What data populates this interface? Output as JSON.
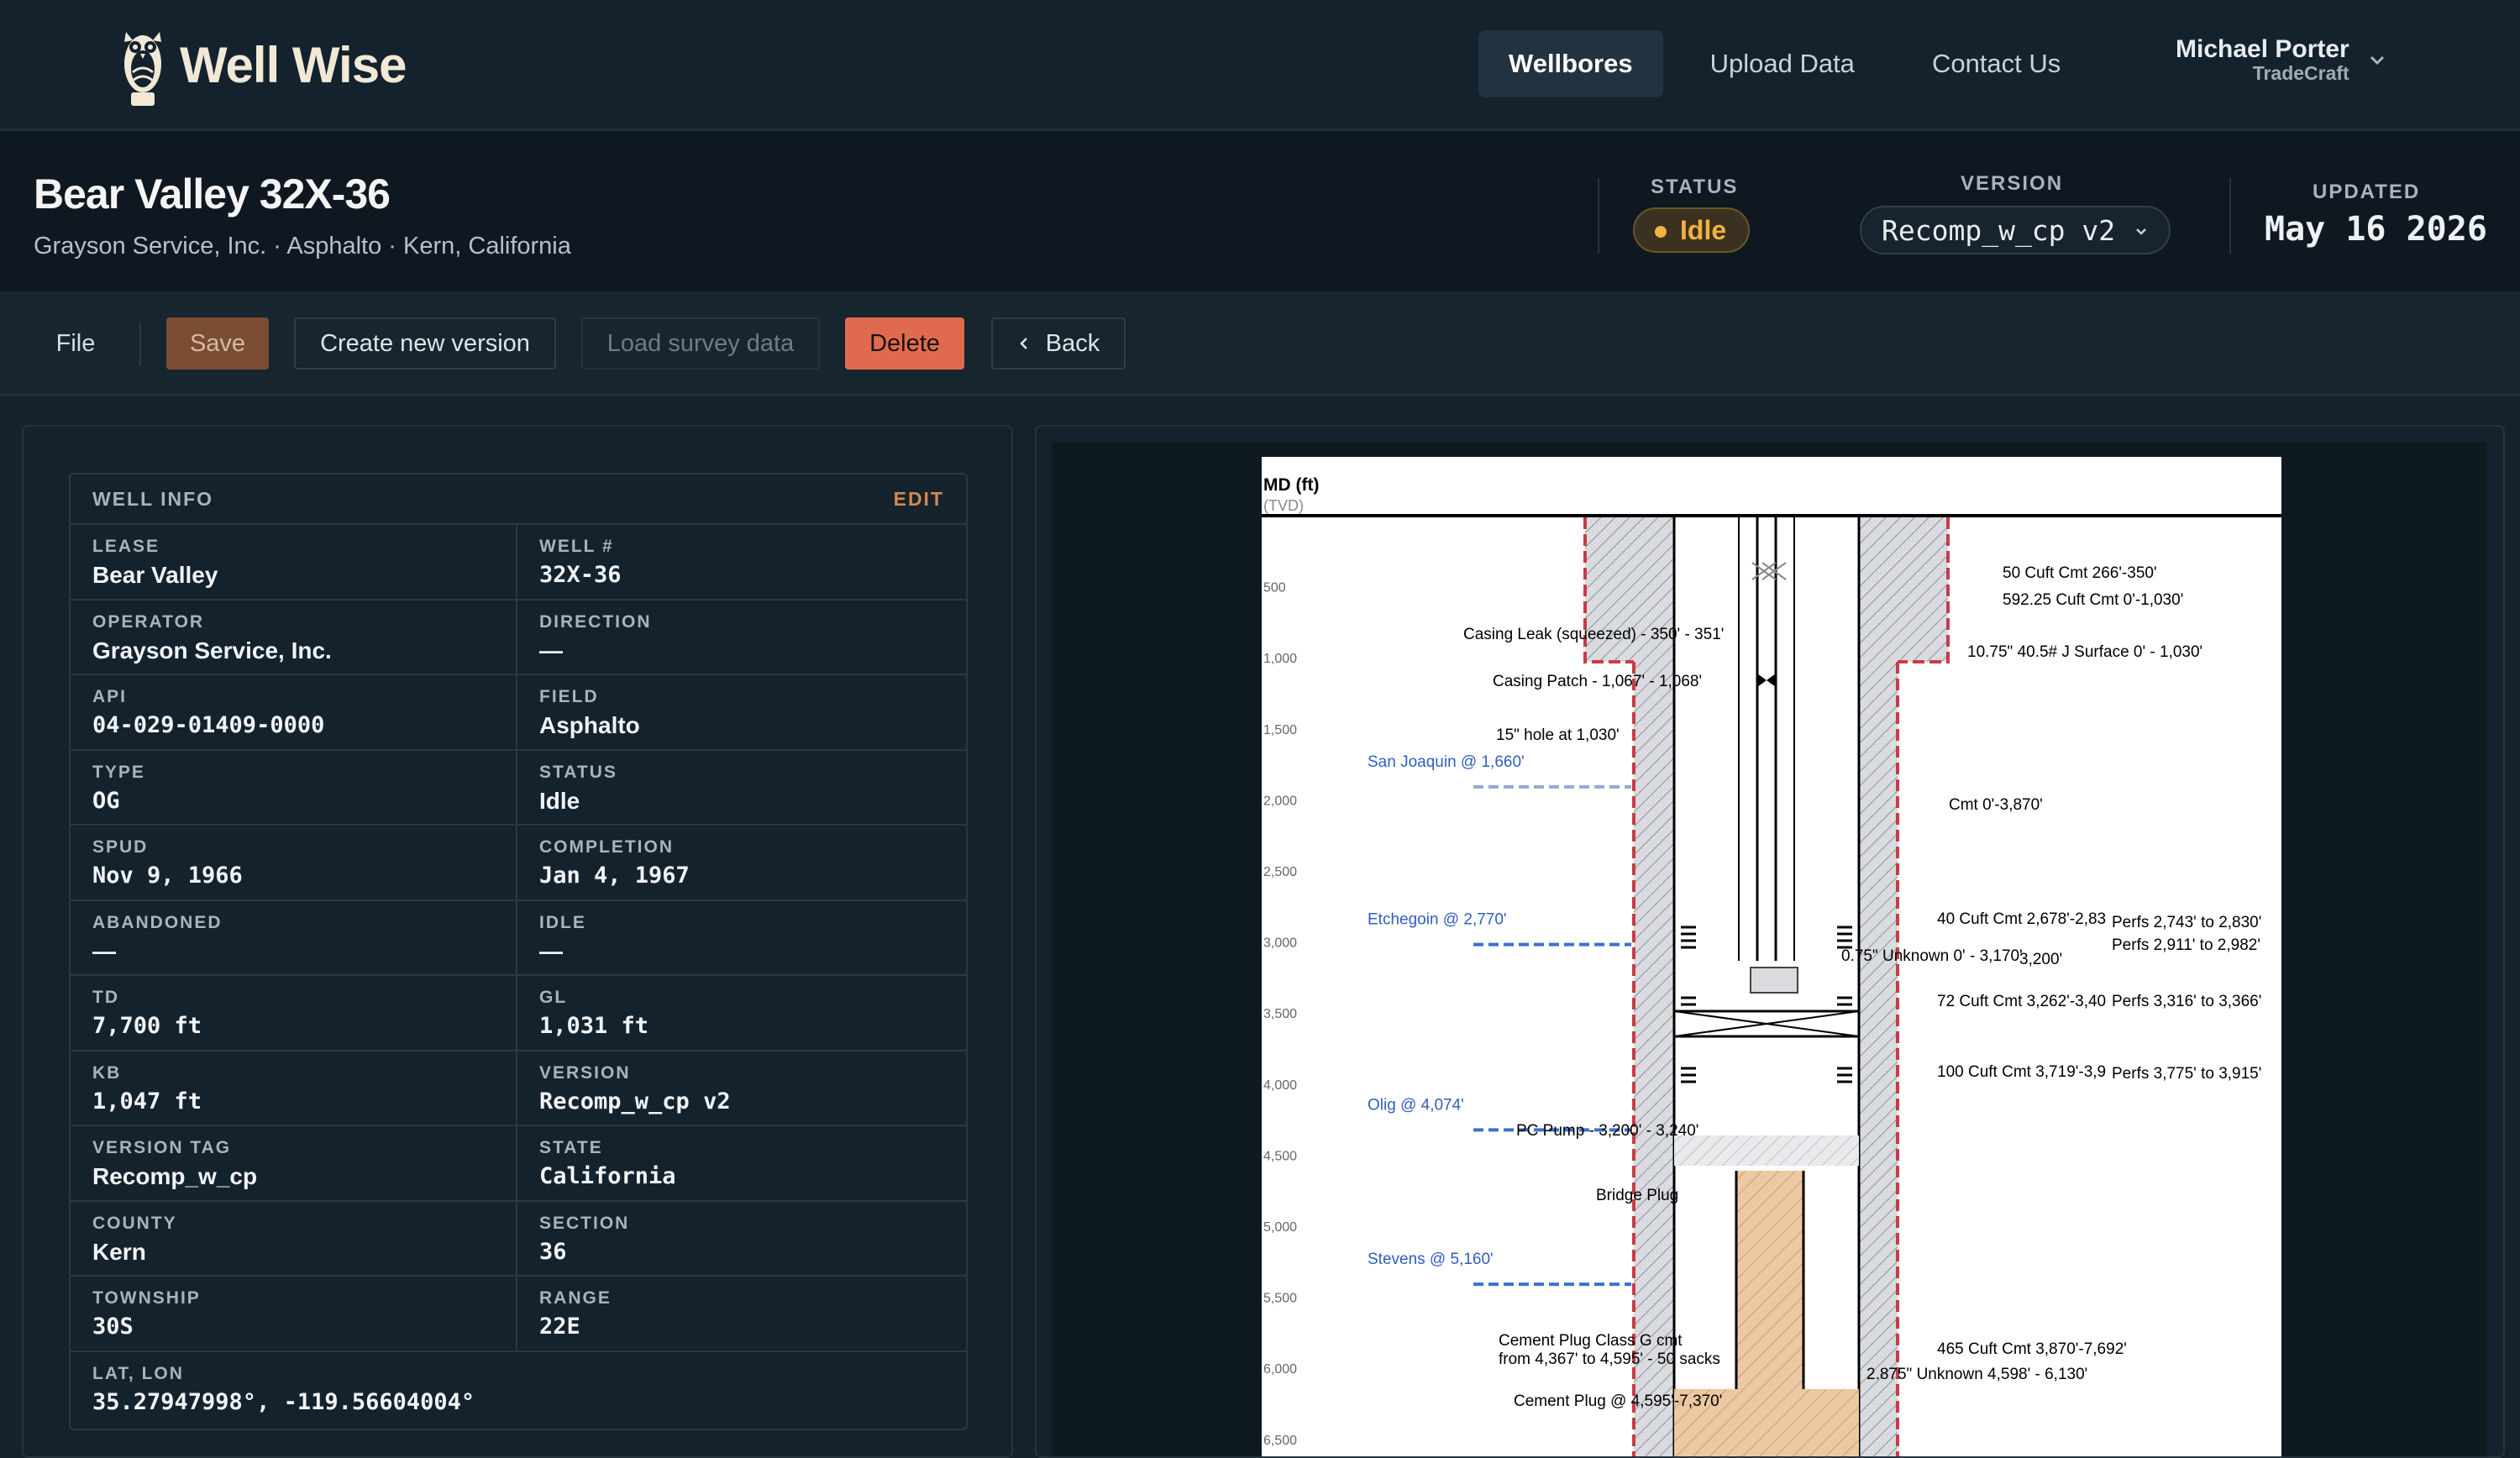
{
  "app": {
    "name": "Well Wise"
  },
  "nav": {
    "items": [
      {
        "label": "Wellbores",
        "active": true
      },
      {
        "label": "Upload Data",
        "active": false
      },
      {
        "label": "Contact Us",
        "active": false
      }
    ],
    "user_name": "Michael Porter",
    "user_org": "TradeCraft"
  },
  "header": {
    "title": "Bear Valley 32X-36",
    "subtitle": "Grayson Service, Inc. · Asphalto · Kern, California",
    "status_label": "STATUS",
    "status_value": "Idle",
    "version_label": "VERSION",
    "version_value": "Recomp_w_cp v2",
    "updated_label": "UPDATED",
    "updated_value": "May 16 2026"
  },
  "toolbar": {
    "file": "File",
    "save": "Save",
    "create_new_version": "Create new version",
    "load_survey": "Load survey data",
    "delete": "Delete",
    "back": "Back"
  },
  "well_info": {
    "title": "WELL INFO",
    "edit": "EDIT",
    "fields": [
      {
        "label": "LEASE",
        "value": "Bear Valley",
        "mono": false
      },
      {
        "label": "WELL #",
        "value": "32X-36",
        "mono": true
      },
      {
        "label": "OPERATOR",
        "value": "Grayson Service, Inc.",
        "mono": false
      },
      {
        "label": "DIRECTION",
        "value": "—",
        "mono": false
      },
      {
        "label": "API",
        "value": "04-029-01409-0000",
        "mono": true
      },
      {
        "label": "FIELD",
        "value": "Asphalto",
        "mono": false
      },
      {
        "label": "TYPE",
        "value": "OG",
        "mono": true
      },
      {
        "label": "STATUS",
        "value": "Idle",
        "mono": false
      },
      {
        "label": "SPUD",
        "value": "Nov 9, 1966",
        "mono": true
      },
      {
        "label": "COMPLETION",
        "value": "Jan 4, 1967",
        "mono": true
      },
      {
        "label": "ABANDONED",
        "value": "—",
        "mono": false
      },
      {
        "label": "IDLE",
        "value": "—",
        "mono": false
      },
      {
        "label": "TD",
        "value": "7,700 ft",
        "mono": true
      },
      {
        "label": "GL",
        "value": "1,031 ft",
        "mono": true
      },
      {
        "label": "KB",
        "value": "1,047 ft",
        "mono": true
      },
      {
        "label": "VERSION",
        "value": "Recomp_w_cp v2",
        "mono": true
      },
      {
        "label": "VERSION TAG",
        "value": "Recomp_w_cp",
        "mono": false
      },
      {
        "label": "STATE",
        "value": "California",
        "mono": true
      },
      {
        "label": "COUNTY",
        "value": "Kern",
        "mono": false
      },
      {
        "label": "SECTION",
        "value": "36",
        "mono": true
      },
      {
        "label": "TOWNSHIP",
        "value": "30S",
        "mono": true
      },
      {
        "label": "RANGE",
        "value": "22E",
        "mono": true
      }
    ],
    "latlon_label": "LAT, LON",
    "latlon_value": "35.27947998°, -119.56604004°"
  },
  "diagram": {
    "axis_title": "MD (ft)",
    "axis_subtitle": "(TVD)",
    "depth_ticks": [
      "500",
      "1,000",
      "1,500",
      "2,000",
      "2,500",
      "3,000",
      "3,500",
      "4,000",
      "4,500",
      "5,000",
      "5,500",
      "6,000",
      "6,500"
    ],
    "formations": [
      {
        "label": "San Joaquin @ 1,660'",
        "depth": 1660
      },
      {
        "label": "Etchegoin @ 2,770'",
        "depth": 2770
      },
      {
        "label": "Olig @ 4,074'",
        "depth": 4074
      },
      {
        "label": "Stevens @ 5,160'",
        "depth": 5160
      }
    ],
    "left_annotations": [
      "Casing Leak (squeezed) - 350' - 351'",
      "Casing Patch - 1,067' - 1,068'",
      "15\" hole at 1,030'",
      "PC Pump - 3,200' - 3,240'",
      "Bridge Plug",
      "Cement Plug Class G cmt",
      "from 4,367' to 4,595' - 50 sacks",
      "Cement Plug @ 4,595'-7,370'"
    ],
    "right_annotations": [
      "50 Cuft Cmt 266'-350'",
      "592.25 Cuft Cmt 0'-1,030'",
      "10.75\" 40.5# J Surface 0' - 1,030'",
      "Cmt 0'-3,870'",
      "40 Cuft Cmt 2,678'-2,83",
      "Perfs 2,743' to 2,830'",
      "Perfs 2,911' to 2,982'",
      "0.75\" Unknown 0' - 3,170'",
      "3,200'",
      "72 Cuft Cmt 3,262'-3,40",
      "Perfs 3,316' to 3,366'",
      "100 Cuft Cmt 3,719'-3,9",
      "Perfs 3,775' to 3,915'",
      "465 Cuft Cmt 3,870'-7,692'",
      "2.875\" Unknown 4,598' - 6,130'"
    ]
  },
  "colors": {
    "background": "#14222e",
    "accent_orange": "#d8864f",
    "delete": "#e06a4f",
    "status_idle": "#f2b23f",
    "formation_line": "#3f6fcf",
    "casing_red": "#d0404a",
    "cement_tan": "#ecc9a2"
  },
  "icons": {
    "logo": "owl-icon",
    "user_menu": "chevron-down-icon",
    "version_menu": "chevron-down-icon",
    "back": "chevron-left-icon"
  }
}
